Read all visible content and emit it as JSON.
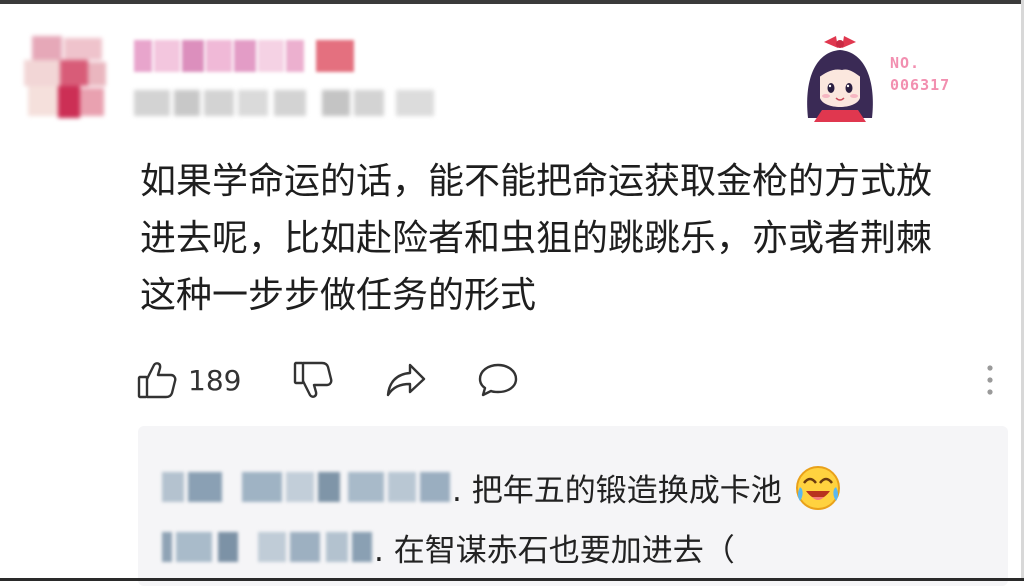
{
  "header": {
    "username": "",
    "meta": "",
    "badge_number_label": "NO.",
    "badge_number_value": "006317",
    "badge_icon": "anime-girl-avatar-icon"
  },
  "comment": {
    "lines": [
      "如果学命运的话，能不能把命运获取金枪的方式放",
      "进去呢，比如赴险者和虫狙的跳跳乐，亦或者荆棘",
      "这种一步步做任务的形式"
    ]
  },
  "actions": {
    "like_icon": "thumbs-up-icon",
    "like_count": "189",
    "dislike_icon": "thumbs-down-icon",
    "share_icon": "share-icon",
    "reply_icon": "chat-bubble-icon",
    "more_icon": "more-vertical-icon"
  },
  "replies": [
    {
      "text": ". 把年五的锻造换成卡池",
      "emoji": "laughing-crying-face-icon"
    },
    {
      "text": ". 在智谋赤石也要加进去（"
    }
  ],
  "colors": {
    "badge_pink": "#f28fb0",
    "reply_bg": "#f5f5f7",
    "text": "#1e1e1e"
  }
}
